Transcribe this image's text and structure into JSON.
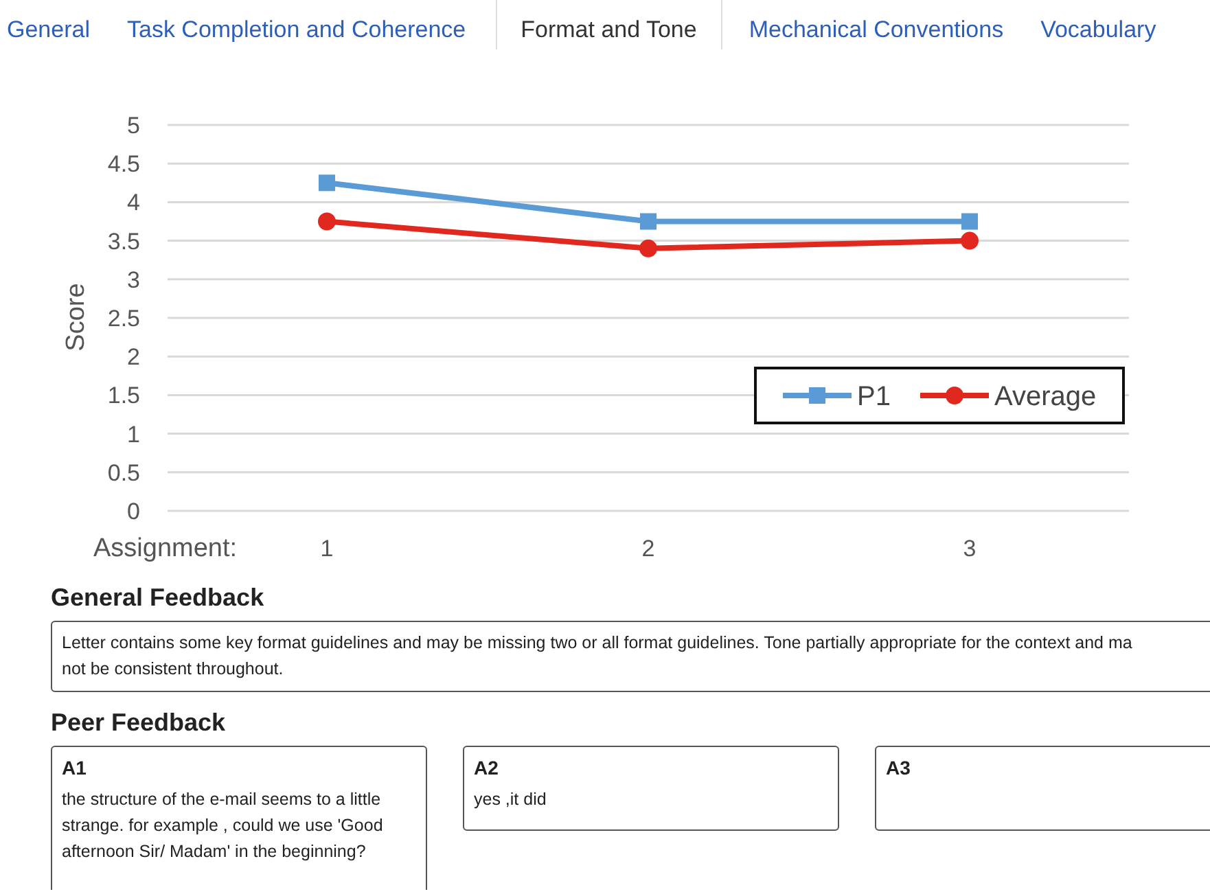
{
  "tabs": [
    {
      "label": "General",
      "selected": false
    },
    {
      "label": "Task Completion and Coherence",
      "selected": false
    },
    {
      "label": "Format and Tone",
      "selected": true
    },
    {
      "label": "Mechanical Conventions",
      "selected": false
    },
    {
      "label": "Vocabulary",
      "selected": false
    }
  ],
  "chart": {
    "chart_data": {
      "type": "line",
      "grid": true,
      "legend": true,
      "ylabel": "Score",
      "xlabel": "Assignment:",
      "categories": [
        "1",
        "2",
        "3"
      ],
      "ylim": [
        0,
        5
      ],
      "yticks": [
        0,
        0.5,
        1,
        1.5,
        2,
        2.5,
        3,
        3.5,
        4,
        4.5,
        5
      ],
      "series": [
        {
          "name": "P1",
          "color": "#5b9bd5",
          "marker": "square",
          "values": [
            4.25,
            3.75,
            3.75
          ]
        },
        {
          "name": "Average",
          "color": "#e0281e",
          "marker": "circle",
          "values": [
            3.75,
            3.4,
            3.5
          ]
        }
      ]
    }
  },
  "general_feedback": {
    "title": "General Feedback",
    "lines": [
      "Letter contains some key format guidelines and may be missing two or all format guidelines. Tone partially appropriate for the context and ma",
      "not be consistent throughout."
    ]
  },
  "peer_feedback": {
    "title": "Peer Feedback",
    "cards": [
      {
        "title": "A1",
        "text": "the structure of the e-mail seems to a little strange. for example , could we use 'Good afternoon Sir/ Madam' in the beginning?"
      },
      {
        "title": "A2",
        "text": "yes ,it did"
      },
      {
        "title": "A3"
      }
    ]
  }
}
